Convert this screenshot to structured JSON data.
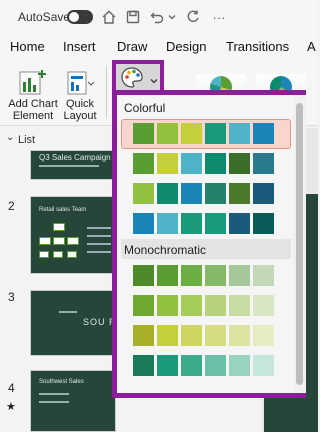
{
  "titlebar": {
    "autosave_label": "AutoSave",
    "icons": [
      "home-icon",
      "save-icon",
      "undo-icon",
      "chevron-down-icon",
      "redo-icon",
      "more-icon"
    ]
  },
  "tabs": [
    "Home",
    "Insert",
    "Draw",
    "Design",
    "Transitions",
    "A"
  ],
  "ribbon": {
    "add_chart_element": "Add Chart\nElement",
    "quick_layout": "Quick\nLayout",
    "color_button_icon": "palette-icon"
  },
  "panel": {
    "list_label": "List",
    "slides": [
      {
        "number": "1",
        "title": "Q3 Sales Campaign"
      },
      {
        "number": "2",
        "title": "Retail sales Team"
      },
      {
        "number": "3",
        "title": "SOU RE"
      },
      {
        "number": "4",
        "title": "Southwest Sales"
      }
    ]
  },
  "dropdown": {
    "sections": [
      {
        "label": "Colorful",
        "rows": [
          [
            "#5a9e33",
            "#94c040",
            "#c5cf3a",
            "#1a9a7a",
            "#4fb3c8",
            "#1a86b8"
          ],
          [
            "#5a9e33",
            "#c5cf3a",
            "#4fb3c8",
            "#0e8a6e",
            "#3c6e2a",
            "#2a7a8e"
          ],
          [
            "#94c040",
            "#0e8a6e",
            "#1a86b8",
            "#25826a",
            "#4a7a2a",
            "#1a5a7a"
          ],
          [
            "#1a86b8",
            "#4fb3c8",
            "#1a9a7a",
            "#1a9a7a",
            "#1a5a7a",
            "#0a5a5a"
          ]
        ]
      },
      {
        "label": "Monochromatic",
        "rows": [
          [
            "#4e8a2c",
            "#5a9e33",
            "#6aae44",
            "#86b86a",
            "#a5c89a",
            "#c2d8b8"
          ],
          [
            "#6ea82e",
            "#94c040",
            "#a6cc5a",
            "#b6d27a",
            "#c6dca0",
            "#d8e6c4"
          ],
          [
            "#a8b02a",
            "#c5cf3a",
            "#cfd660",
            "#d6dc80",
            "#dee2a2",
            "#e6ebc4"
          ],
          [
            "#1a7a5a",
            "#1a9a7a",
            "#3aaa8a",
            "#6ac0a6",
            "#9ad2c2",
            "#c4e6dc"
          ]
        ]
      }
    ]
  }
}
